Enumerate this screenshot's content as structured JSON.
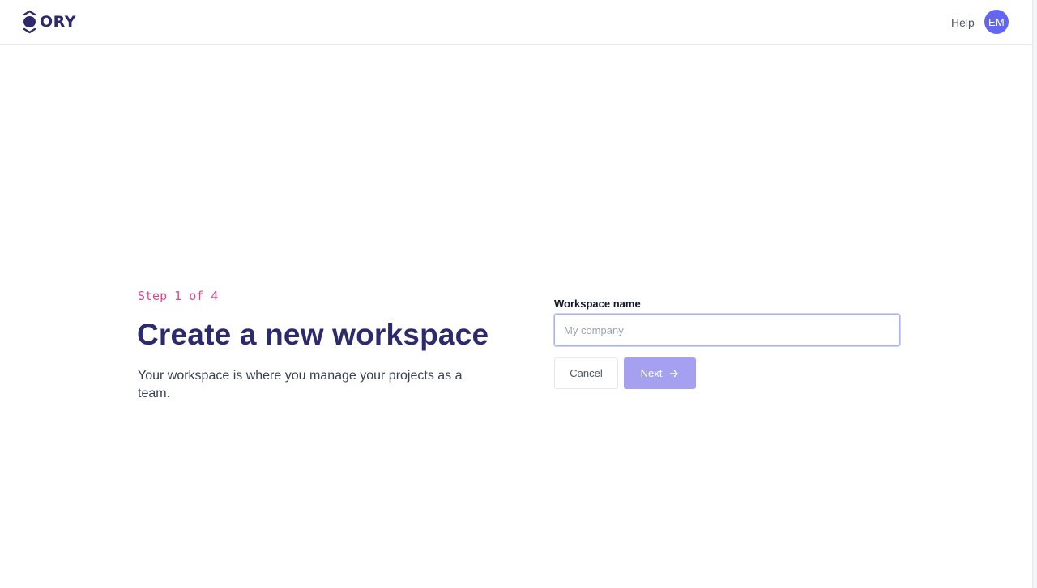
{
  "header": {
    "brand": "ORY",
    "help_label": "Help",
    "avatar_initials": "EM"
  },
  "main": {
    "step_label": "Step 1 of 4",
    "title": "Create a new workspace",
    "description": "Your workspace is where you manage your projects as a team."
  },
  "form": {
    "workspace_label": "Workspace name",
    "workspace_placeholder": "My company",
    "workspace_value": "",
    "cancel_label": "Cancel",
    "next_label": "Next"
  },
  "colors": {
    "brand": "#2c2a6b",
    "accent": "#6366f1",
    "step": "#e0458f",
    "next_button": "#a5a0f0"
  },
  "icons": {
    "logo": "ory-logo-icon",
    "next": "arrow-right-icon"
  }
}
